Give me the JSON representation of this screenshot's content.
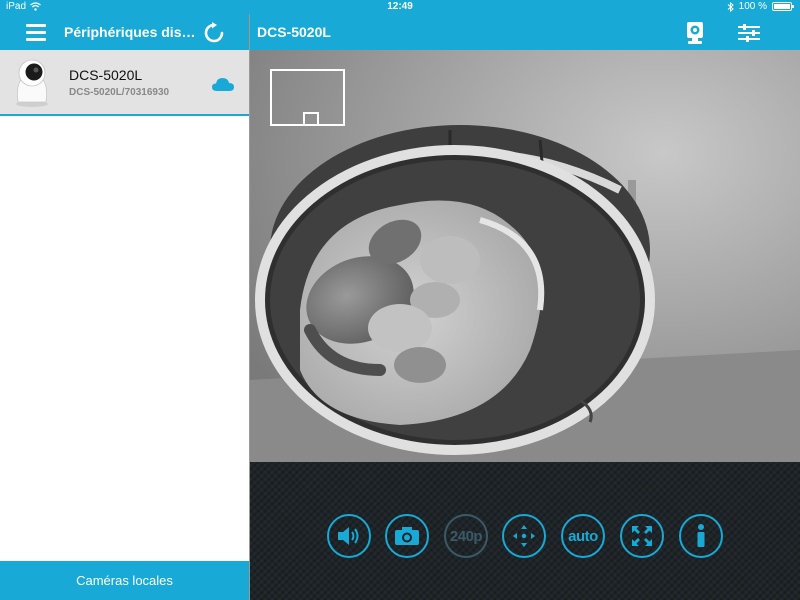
{
  "status_bar": {
    "device": "iPad",
    "time": "12:49",
    "battery": "100 %"
  },
  "sidebar": {
    "title": "Périphériques dis…",
    "devices": [
      {
        "name": "DCS-5020L",
        "id": "DCS-5020L/70316930"
      }
    ],
    "footer_label": "Caméras locales"
  },
  "camera_view": {
    "title": "DCS-5020L"
  },
  "controls": {
    "resolution_label": "240p",
    "mode_label": "auto"
  },
  "colors": {
    "accent": "#19a9d6",
    "control_bg": "#1e2428"
  },
  "icons": [
    "menu-icon",
    "refresh-icon",
    "cloud-icon",
    "camera-icon",
    "settings-icon",
    "speaker-icon",
    "snapshot-icon",
    "pan-tilt-icon",
    "fullscreen-icon",
    "info-icon"
  ]
}
